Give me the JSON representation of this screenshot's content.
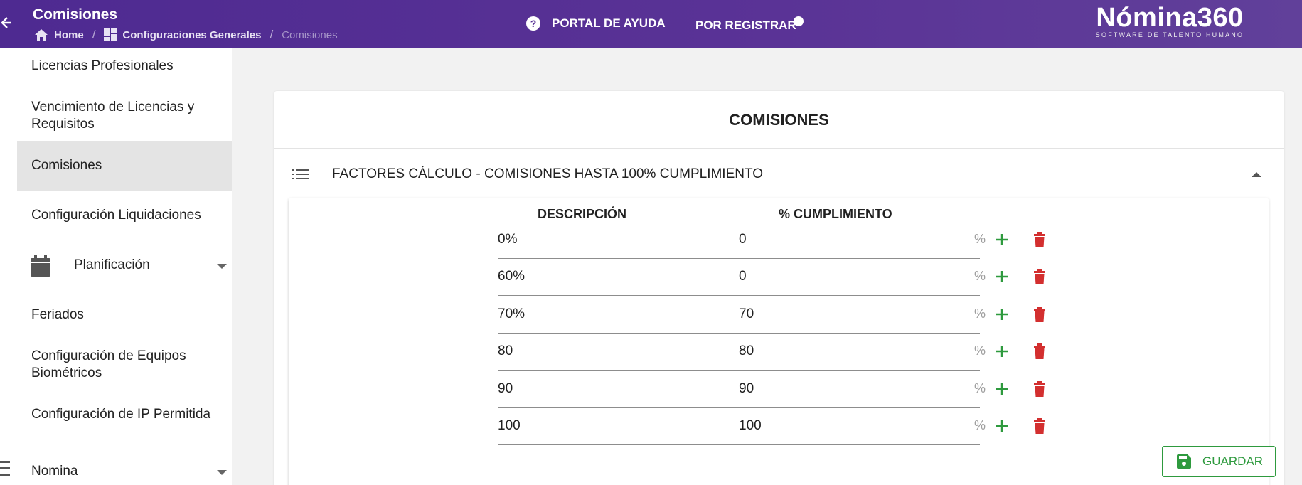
{
  "header": {
    "title": "Comisiones",
    "breadcrumb": [
      "Home",
      "Configuraciones Generales",
      "Comisiones"
    ],
    "help_label": "PORTAL DE AYUDA",
    "register_label": "POR REGISTRAR",
    "logo_main": "Nómina360",
    "logo_sub": "SOFTWARE DE TALENTO HUMANO",
    "color": "#5a3396"
  },
  "sidebar": {
    "items": [
      "Licencias Profesionales",
      "Vencimiento de Licencias y Requisitos",
      "Comisiones",
      "Configuración Liquidaciones",
      "Planificación",
      "Feriados",
      "Configuración de Equipos Biométricos",
      "Configuración de IP Permitida",
      "Nomina"
    ],
    "active": "Comisiones"
  },
  "card": {
    "title": "COMISIONES",
    "section_title": "FACTORES CÁLCULO - COMISIONES HASTA 100% CUMPLIMIENTO",
    "col_desc": "DESCRIPCIÓN",
    "col_pct": "% CUMPLIMIENTO",
    "unit": "%",
    "rows": [
      {
        "desc": "0%",
        "value": "0"
      },
      {
        "desc": "60%",
        "value": "0"
      },
      {
        "desc": "70%",
        "value": "70"
      },
      {
        "desc": "80",
        "value": "80"
      },
      {
        "desc": "90",
        "value": "90"
      },
      {
        "desc": "100",
        "value": "100"
      }
    ],
    "save_label": "GUARDAR"
  },
  "colors": {
    "add": "#2e9a3e",
    "delete": "#d32f2f"
  }
}
